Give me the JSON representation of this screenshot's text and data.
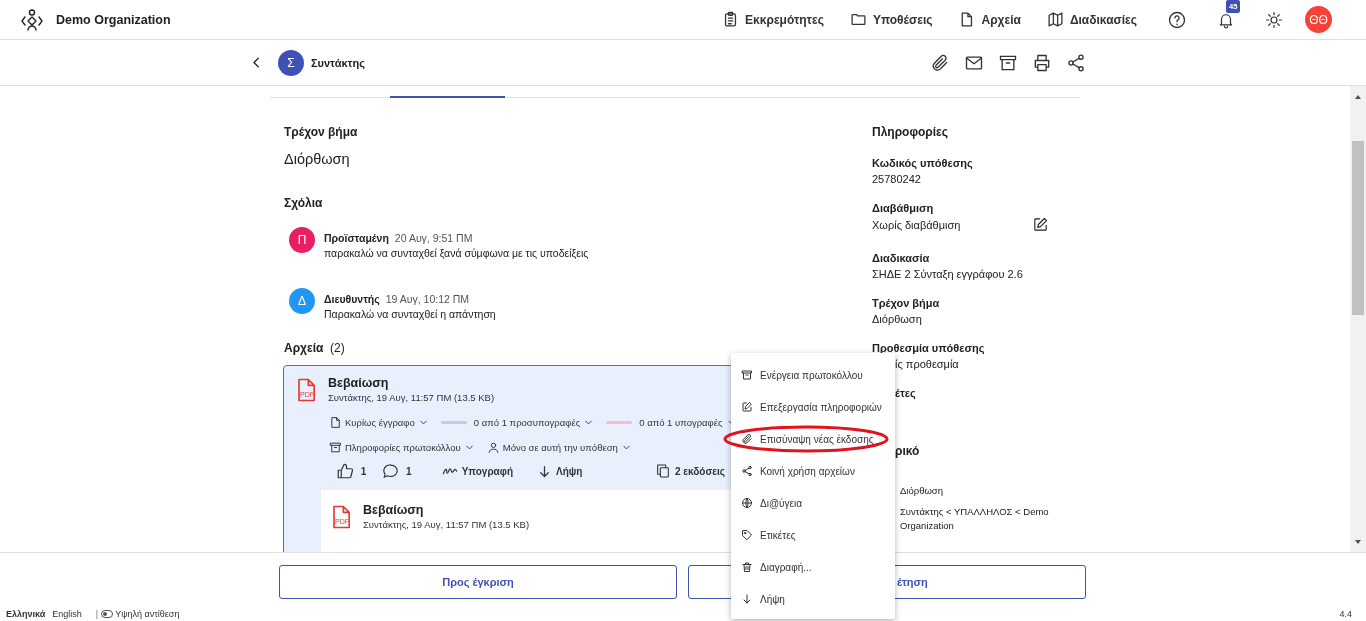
{
  "header": {
    "org": "Demo Organization",
    "nav": [
      {
        "label": "Εκκρεμότητες"
      },
      {
        "label": "Υποθέσεις"
      },
      {
        "label": "Αρχεία"
      },
      {
        "label": "Διαδικασίες"
      }
    ],
    "notifications": "45",
    "user_initials": "ΘΘ"
  },
  "case_bar": {
    "initial": "Σ",
    "role": "Συντάκτης"
  },
  "current_step": {
    "label": "Τρέχον βήμα",
    "value": "Διόρθωση"
  },
  "comments": {
    "title": "Σχόλια",
    "items": [
      {
        "initial": "Π",
        "color": "#e91e63",
        "author": "Προϊσταμένη",
        "date": "20 Αυγ, 9:51 ΠΜ",
        "text": "παρακαλώ να συνταχθεί ξανά σύμφωνα με τις υποδείξεις"
      },
      {
        "initial": "Δ",
        "color": "#2196f3",
        "author": "Διευθυντής",
        "date": "19 Αυγ, 10:12 ΠΜ",
        "text": "Παρακαλώ να συνταχθεί η απάντηση"
      }
    ]
  },
  "files": {
    "title": "Αρχεία",
    "count": "(2)",
    "file": {
      "name": "Βεβαίωση",
      "badge": "PDF",
      "meta": "Συντάκτης,  19 Αυγ, 11:57 ΠΜ (13.5 KB)",
      "tags": [
        {
          "kind": "dropdown",
          "label": "Κυρίως έγγραφο"
        },
        {
          "kind": "progress",
          "color": "#c5cae9",
          "label": "0 από 1 προσυπογραφές"
        },
        {
          "kind": "progress",
          "color": "#f8bbd0",
          "label": "0 από 1 υπογραφές"
        },
        {
          "kind": "dropdown",
          "label": "Πληροφορίες πρωτοκόλλου"
        },
        {
          "kind": "dropdown",
          "label": "Μόνο σε αυτή την υπόθεση"
        }
      ],
      "likes": "1",
      "comment_count": "1",
      "sign": "Υπογραφή",
      "download": "Λήψη",
      "versions": "2 εκδόσεις",
      "version": {
        "name": "Βεβαίωση",
        "badge": "PDF",
        "meta": "Συντάκτης,  19 Αυγ, 11:57 ΠΜ (13.5 KB)"
      }
    }
  },
  "info": {
    "title": "Πληροφορίες",
    "fields": [
      {
        "label": "Κωδικός υπόθεσης",
        "value": "25780242",
        "editable": false
      },
      {
        "label": "Διαβάθμιση",
        "value": "Χωρίς διαβάθμιση",
        "editable": true
      },
      {
        "label": "Διαδικασία",
        "value": "ΣΗΔΕ 2 Σύνταξη εγγράφου 2.6",
        "editable": false
      },
      {
        "label": "Τρέχον βήμα",
        "value": "Διόρθωση",
        "editable": false
      }
    ],
    "deadline_label": "Προθεσμία υπόθεσης",
    "deadline_value": "ίς προθεσμία",
    "tags_label": "έτες",
    "history_title": "ρικό",
    "history": [
      {
        "step": "Διόρθωση",
        "path": "Συντάκτης < ΥΠΑΛΛΗΛΟΣ < Demo Organization"
      }
    ]
  },
  "menu": [
    {
      "label": "Ενέργεια πρωτοκόλλου",
      "circled": false
    },
    {
      "label": "Επεξεργασία πληροφοριών",
      "circled": false
    },
    {
      "label": "Επισύναψη νέας έκδοσης",
      "circled": true
    },
    {
      "label": "Κοινή χρήση αρχείων",
      "circled": false
    },
    {
      "label": "Δι@ύγεια",
      "circled": false
    },
    {
      "label": "Ετικέτες",
      "circled": false
    },
    {
      "label": "Διαγραφή...",
      "circled": false
    },
    {
      "label": "Λήψη",
      "circled": false
    }
  ],
  "footer_buttons": [
    "Προς έγκριση",
    "έτηση"
  ],
  "status_bar": {
    "languages": [
      {
        "label": "Ελληνικά",
        "selected": true
      },
      {
        "label": "English",
        "selected": false
      }
    ],
    "separator": "|",
    "high_contrast": {
      "label": "Υψηλή αντίθεση",
      "on": false
    },
    "version": "4.4"
  }
}
